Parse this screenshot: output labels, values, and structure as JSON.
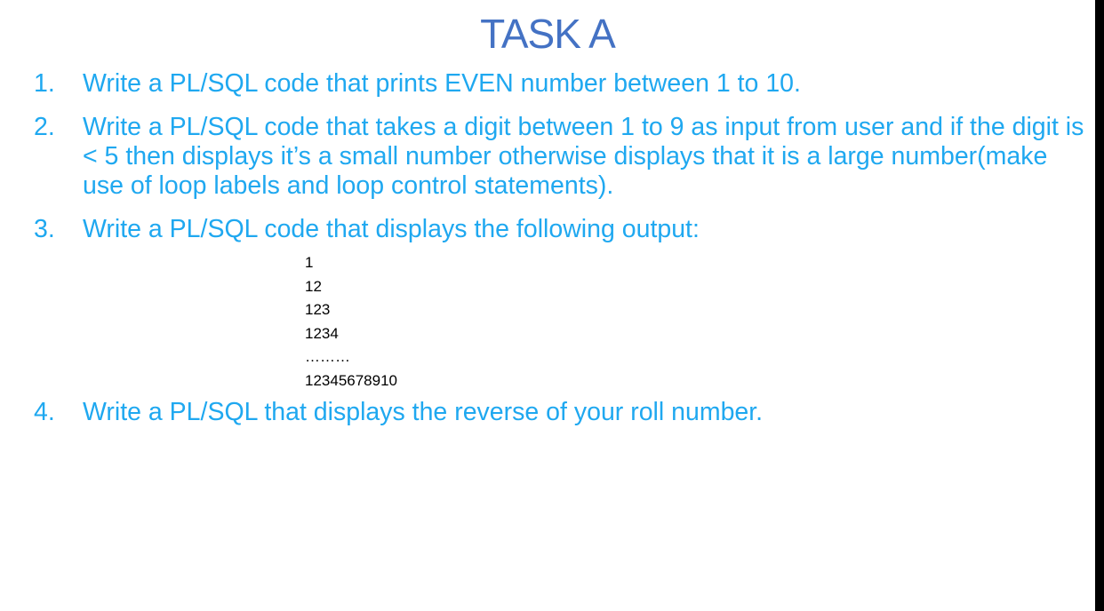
{
  "title": "TASK A",
  "tasks": [
    {
      "number": "1.",
      "text": "Write a PL/SQL code that prints EVEN number between 1 to 10."
    },
    {
      "number": "2.",
      "text": "Write a PL/SQL code that takes a digit between 1 to 9 as input from user and if the digit is < 5 then displays it’s a small number otherwise displays that it is a large number(make use of loop labels and loop control statements)."
    },
    {
      "number": "3.",
      "text": "Write a PL/SQL code that displays the following output:",
      "output": [
        "1",
        "12",
        "123",
        "1234",
        "………",
        "12345678910"
      ]
    },
    {
      "number": "4.",
      "text": "Write a PL/SQL that displays the reverse of your roll number."
    }
  ],
  "colors": {
    "title": "#4472c4",
    "task_text": "#1fa8f0",
    "output_text": "#000000",
    "right_border": "#000000"
  }
}
